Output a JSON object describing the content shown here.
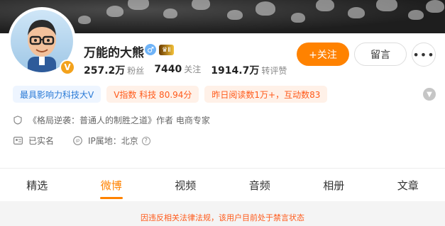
{
  "profile": {
    "name": "万能的大熊",
    "gender_symbol": "♂",
    "level_badge": "Ⅱ",
    "verified_symbol": "V",
    "stats": [
      {
        "value": "257.2万",
        "label": "粉丝"
      },
      {
        "value": "7440",
        "label": "关注"
      },
      {
        "value": "1914.7万",
        "label": "转评赞"
      }
    ]
  },
  "actions": {
    "follow_label": "+关注",
    "message_label": "留言",
    "more_label": "•••"
  },
  "tags": [
    {
      "text": "最具影响力科技大V"
    },
    {
      "text": "V指数 科技 80.94分"
    },
    {
      "text": "昨日阅读数1万+，互动数83"
    }
  ],
  "info": {
    "bio": "《格局逆袭：普通人的制胜之道》作者 电商专家",
    "real_name": "已实名",
    "ip_location": "IP属地：北京"
  },
  "tabs": [
    {
      "label": "精选"
    },
    {
      "label": "微博"
    },
    {
      "label": "视频"
    },
    {
      "label": "音频"
    },
    {
      "label": "相册"
    },
    {
      "label": "文章"
    }
  ],
  "active_tab": "微博",
  "notice": "因违反相关法律法规，该用户目前处于禁言状态",
  "colors": {
    "accent": "#ff8200",
    "notice": "#ff5a1a",
    "tag_blue": "#2a7ad6"
  }
}
